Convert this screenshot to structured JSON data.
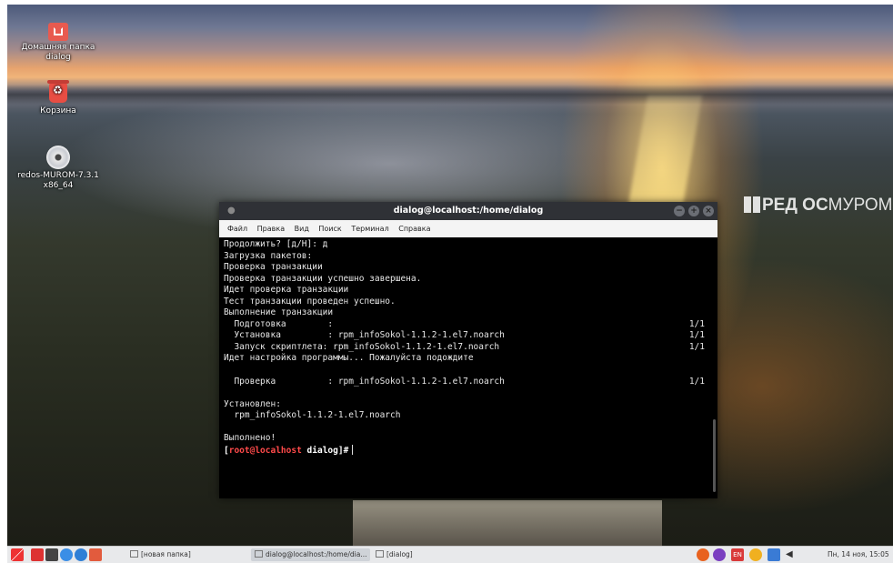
{
  "desktop": {
    "icons": [
      {
        "label_line1": "Домашняя папка",
        "label_line2": "dialog"
      },
      {
        "label_line1": "Корзина"
      },
      {
        "label_line1": "redos-MUROM-7.3.1",
        "label_line2": "x86_64"
      }
    ],
    "brand": {
      "part1": "РЕД ОС",
      "part2": "МУРОМ"
    }
  },
  "terminal": {
    "title": "dialog@localhost:/home/dialog",
    "menu": [
      "Файл",
      "Правка",
      "Вид",
      "Поиск",
      "Терминал",
      "Справка"
    ],
    "lines": [
      {
        "text": "Продолжить? [д/Н]: д"
      },
      {
        "text": "Загрузка пакетов:"
      },
      {
        "text": "Проверка транзакции"
      },
      {
        "text": "Проверка транзакции успешно завершена."
      },
      {
        "text": "Идет проверка транзакции"
      },
      {
        "text": "Тест транзакции проведен успешно."
      },
      {
        "text": "Выполнение транзакции"
      },
      {
        "text": "  Подготовка        :",
        "count": "1/1"
      },
      {
        "text": "  Установка         : rpm_infoSokol-1.1.2-1.el7.noarch",
        "count": "1/1"
      },
      {
        "text": "  Запуск скриптлета: rpm_infoSokol-1.1.2-1.el7.noarch",
        "count": "1/1"
      },
      {
        "text": "Идет настройка программы... Пожалуйста подождите"
      },
      {
        "text": ""
      },
      {
        "text": "  Проверка          : rpm_infoSokol-1.1.2-1.el7.noarch",
        "count": "1/1"
      },
      {
        "text": ""
      },
      {
        "text": "Установлен:"
      },
      {
        "text": "  rpm_infoSokol-1.1.2-1.el7.noarch"
      },
      {
        "text": ""
      },
      {
        "text": "Выполнено!"
      }
    ],
    "prompt": {
      "open": "[",
      "user": "root@localhost",
      "dir": " dialog",
      "close": "]#"
    }
  },
  "taskbar": {
    "tasks": [
      "[новая папка]",
      "dialog@localhost:/home/dia...",
      "[dialog]"
    ],
    "tray_lang": "EN",
    "clock": "Пн, 14 ноя, 15:05"
  },
  "colors": {
    "terminal_bg": "#000000",
    "prompt_red": "#ff4a4a",
    "titlebar": "#2f3136",
    "taskbar": "#e8e9eb"
  }
}
